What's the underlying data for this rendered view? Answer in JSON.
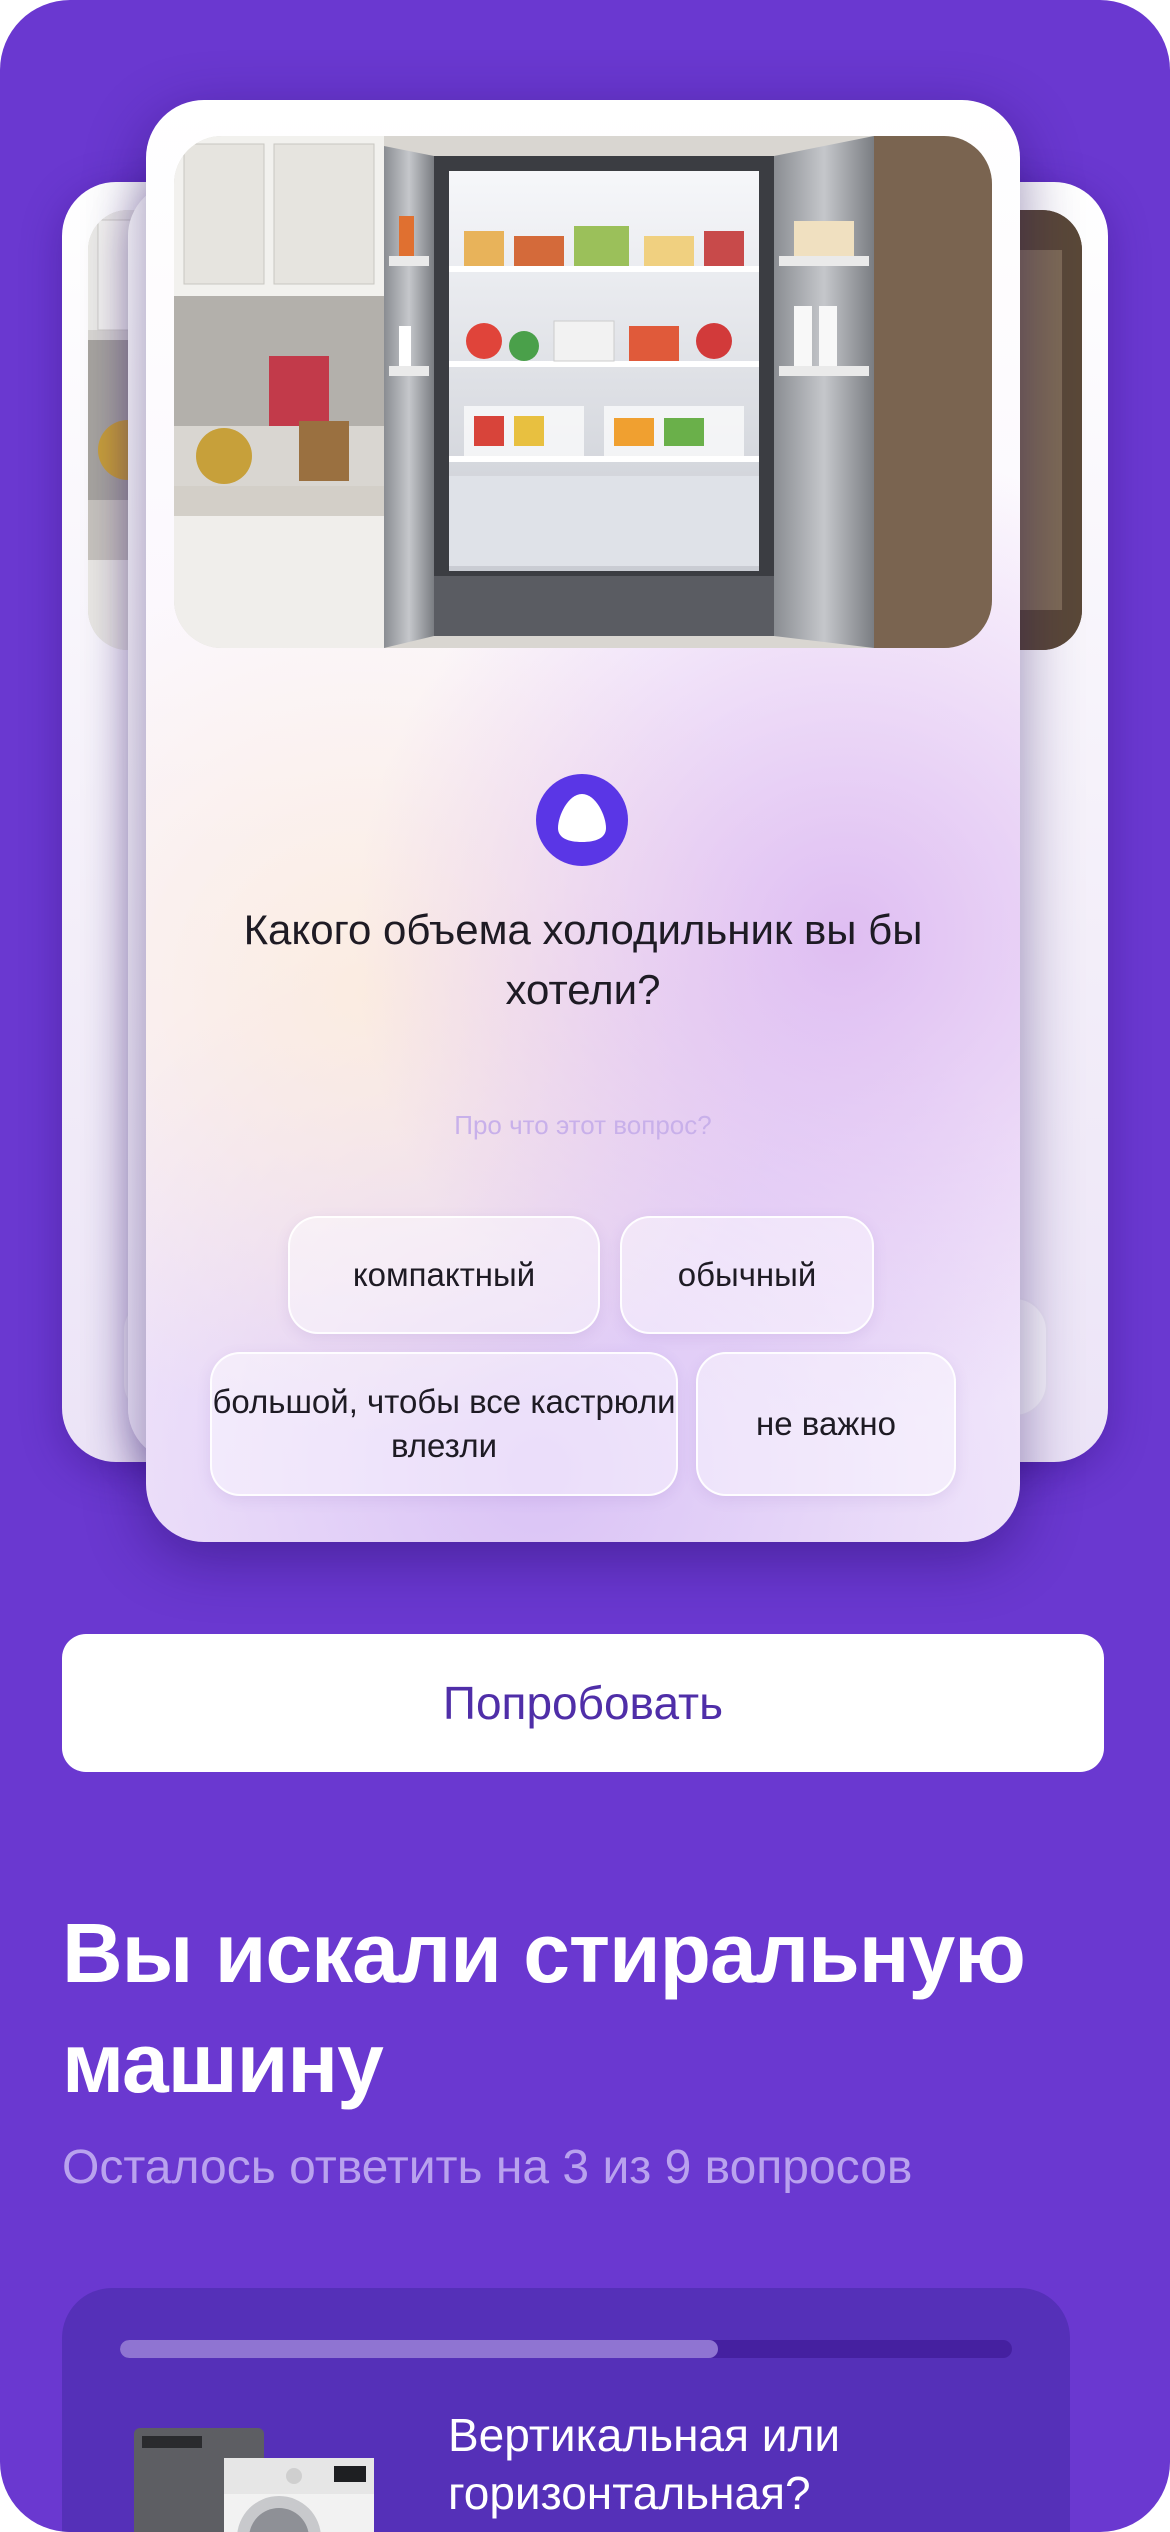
{
  "colors": {
    "screen_background": "#6a38d0",
    "button_text": "#4f2ea8",
    "subtitle": "#b9a2ee",
    "alice_logo": "#5a36e6"
  },
  "quiz_card": {
    "image": "refrigerator-photo",
    "logo": "alice-icon",
    "question": "Какого объема холодильник вы бы хотели?",
    "about_link": "Про что этот вопрос?",
    "options": [
      "компактный",
      "обычный",
      "большой, чтобы все кастрюли влезли",
      "не важно"
    ]
  },
  "try_button": {
    "label": "Попробовать"
  },
  "search_section": {
    "title": "Вы искали стиральную машину",
    "subtitle": "Осталось ответить на 3 из 9 вопросов",
    "progress": 0.67,
    "next_question_image": "washing-machine-photo",
    "next_question": "Вертикальная или горизонтальная?"
  }
}
